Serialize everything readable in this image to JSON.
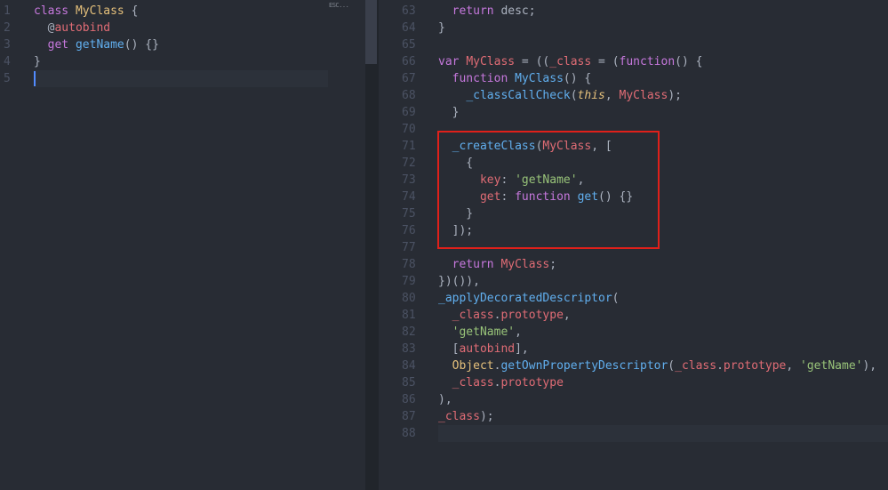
{
  "left_editor": {
    "minimap_label": "ESC...",
    "lines": [
      {
        "n": "1",
        "tokens": [
          [
            "kw",
            "class "
          ],
          [
            "cls",
            "MyClass"
          ],
          [
            "plain",
            " {"
          ]
        ]
      },
      {
        "n": "2",
        "tokens": [
          [
            "plain",
            "  @"
          ],
          [
            "prop",
            "autobind"
          ]
        ]
      },
      {
        "n": "3",
        "tokens": [
          [
            "plain",
            "  "
          ],
          [
            "kw",
            "get "
          ],
          [
            "fn",
            "getName"
          ],
          [
            "plain",
            "() {}"
          ]
        ]
      },
      {
        "n": "4",
        "tokens": [
          [
            "plain",
            "}"
          ]
        ]
      },
      {
        "n": "5",
        "tokens": []
      }
    ]
  },
  "right_editor": {
    "lines": [
      {
        "n": "63",
        "tokens": [
          [
            "plain",
            "  "
          ],
          [
            "kw",
            "return "
          ],
          [
            "plain",
            "desc;"
          ]
        ]
      },
      {
        "n": "64",
        "tokens": [
          [
            "plain",
            "}"
          ]
        ]
      },
      {
        "n": "65",
        "tokens": []
      },
      {
        "n": "66",
        "tokens": [
          [
            "kw",
            "var "
          ],
          [
            "prop",
            "MyClass"
          ],
          [
            "plain",
            " = (("
          ],
          [
            "prop",
            "_class"
          ],
          [
            "plain",
            " = ("
          ],
          [
            "kw",
            "function"
          ],
          [
            "plain",
            "() {"
          ]
        ]
      },
      {
        "n": "67",
        "tokens": [
          [
            "plain",
            "  "
          ],
          [
            "kw",
            "function "
          ],
          [
            "fn",
            "MyClass"
          ],
          [
            "plain",
            "() {"
          ]
        ]
      },
      {
        "n": "68",
        "tokens": [
          [
            "plain",
            "    "
          ],
          [
            "fn",
            "_classCallCheck"
          ],
          [
            "plain",
            "("
          ],
          [
            "this",
            "this"
          ],
          [
            "plain",
            ", "
          ],
          [
            "prop",
            "MyClass"
          ],
          [
            "plain",
            ");"
          ]
        ]
      },
      {
        "n": "69",
        "tokens": [
          [
            "plain",
            "  }"
          ]
        ]
      },
      {
        "n": "70",
        "tokens": []
      },
      {
        "n": "71",
        "tokens": [
          [
            "plain",
            "  "
          ],
          [
            "fn",
            "_createClass"
          ],
          [
            "plain",
            "("
          ],
          [
            "prop",
            "MyClass"
          ],
          [
            "plain",
            ", ["
          ]
        ]
      },
      {
        "n": "72",
        "tokens": [
          [
            "plain",
            "    {"
          ]
        ]
      },
      {
        "n": "73",
        "tokens": [
          [
            "plain",
            "      "
          ],
          [
            "prop",
            "key"
          ],
          [
            "plain",
            ": "
          ],
          [
            "str",
            "'getName'"
          ],
          [
            "plain",
            ","
          ]
        ]
      },
      {
        "n": "74",
        "tokens": [
          [
            "plain",
            "      "
          ],
          [
            "prop",
            "get"
          ],
          [
            "plain",
            ": "
          ],
          [
            "kw",
            "function "
          ],
          [
            "fn",
            "get"
          ],
          [
            "plain",
            "() {}"
          ]
        ]
      },
      {
        "n": "75",
        "tokens": [
          [
            "plain",
            "    }"
          ]
        ]
      },
      {
        "n": "76",
        "tokens": [
          [
            "plain",
            "  ]);"
          ]
        ]
      },
      {
        "n": "77",
        "tokens": []
      },
      {
        "n": "78",
        "tokens": [
          [
            "plain",
            "  "
          ],
          [
            "kw",
            "return "
          ],
          [
            "prop",
            "MyClass"
          ],
          [
            "plain",
            ";"
          ]
        ]
      },
      {
        "n": "79",
        "tokens": [
          [
            "plain",
            "})()),"
          ]
        ]
      },
      {
        "n": "80",
        "tokens": [
          [
            "fn",
            "_applyDecoratedDescriptor"
          ],
          [
            "plain",
            "("
          ]
        ]
      },
      {
        "n": "81",
        "tokens": [
          [
            "plain",
            "  "
          ],
          [
            "prop",
            "_class"
          ],
          [
            "plain",
            "."
          ],
          [
            "prop",
            "prototype"
          ],
          [
            "plain",
            ","
          ]
        ]
      },
      {
        "n": "82",
        "tokens": [
          [
            "plain",
            "  "
          ],
          [
            "str",
            "'getName'"
          ],
          [
            "plain",
            ","
          ]
        ]
      },
      {
        "n": "83",
        "tokens": [
          [
            "plain",
            "  ["
          ],
          [
            "prop",
            "autobind"
          ],
          [
            "plain",
            "],"
          ]
        ]
      },
      {
        "n": "84",
        "tokens": [
          [
            "plain",
            "  "
          ],
          [
            "cls",
            "Object"
          ],
          [
            "plain",
            "."
          ],
          [
            "fn",
            "getOwnPropertyDescriptor"
          ],
          [
            "plain",
            "("
          ],
          [
            "prop",
            "_class"
          ],
          [
            "plain",
            "."
          ],
          [
            "prop",
            "prototype"
          ],
          [
            "plain",
            ", "
          ],
          [
            "str",
            "'getName'"
          ],
          [
            "plain",
            "),"
          ]
        ]
      },
      {
        "n": "85",
        "tokens": [
          [
            "plain",
            "  "
          ],
          [
            "prop",
            "_class"
          ],
          [
            "plain",
            "."
          ],
          [
            "prop",
            "prototype"
          ]
        ]
      },
      {
        "n": "86",
        "tokens": [
          [
            "plain",
            "),"
          ]
        ]
      },
      {
        "n": "87",
        "tokens": [
          [
            "prop",
            "_class"
          ],
          [
            "plain",
            ");"
          ]
        ]
      },
      {
        "n": "88",
        "tokens": []
      }
    ]
  },
  "colors": {
    "background": "#282c34",
    "highlight_border": "#e0201a",
    "keyword": "#c678dd",
    "function": "#61afef",
    "string": "#98c379",
    "property": "#e06c75",
    "class": "#e5c07b"
  }
}
